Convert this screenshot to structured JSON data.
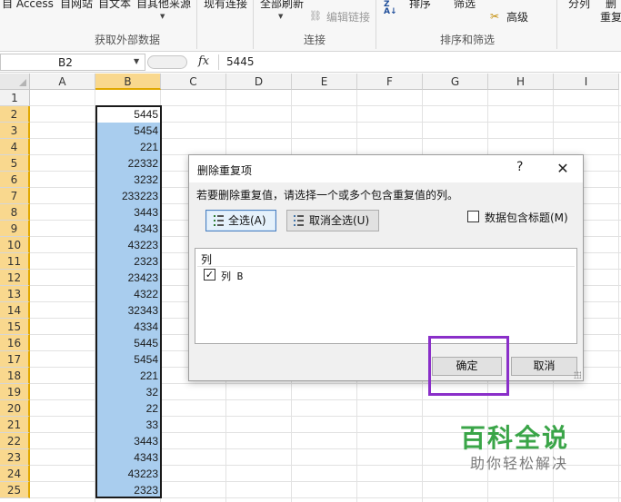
{
  "ribbon": {
    "partial_top": [
      {
        "name": "from-access",
        "label": "自 Access"
      },
      {
        "name": "from-web",
        "label": "自网站"
      },
      {
        "name": "from-text",
        "label": "自文本"
      },
      {
        "name": "from-other-sources",
        "label": "自其他来源"
      },
      {
        "name": "existing-connections",
        "label": "现有连接"
      },
      {
        "name": "refresh-all",
        "label": "全部刷新"
      },
      {
        "name": "sort",
        "label": "排序"
      },
      {
        "name": "filter",
        "label": "筛选"
      },
      {
        "name": "split",
        "label": "分列"
      },
      {
        "name": "remove-dup-partial",
        "label": "删"
      }
    ],
    "edit_links": "编辑链接",
    "advanced": "高级",
    "reapply_partial": "重复",
    "groups": {
      "get_external": "获取外部数据",
      "connections": "连接",
      "sort_filter": "排序和筛选"
    }
  },
  "formula_bar": {
    "name_box": "B2",
    "fx": "fx",
    "value": "5445"
  },
  "grid": {
    "columns": [
      "A",
      "B",
      "C",
      "D",
      "E",
      "F",
      "G",
      "H",
      "I"
    ],
    "selected_column": "B",
    "rows": [
      "1",
      "2",
      "3",
      "4",
      "5",
      "6",
      "7",
      "8",
      "9",
      "10",
      "11",
      "12",
      "13",
      "14",
      "15",
      "16",
      "17",
      "18",
      "19",
      "20",
      "21",
      "22",
      "23",
      "24",
      "25"
    ],
    "column_b_values": [
      "5445",
      "5454",
      "221",
      "22332",
      "3232",
      "233223",
      "3443",
      "4343",
      "43223",
      "2323",
      "23423",
      "4322",
      "32343",
      "4334",
      "5445",
      "5454",
      "221",
      "32",
      "22",
      "33",
      "3443",
      "4343",
      "43223",
      "2323"
    ]
  },
  "dialog": {
    "title": "删除重复项",
    "help": "?",
    "close": "✕",
    "instruction": "若要删除重复值，请选择一个或多个包含重复值的列。",
    "select_all": "全选(A)",
    "unselect_all": "取消全选(U)",
    "has_headers_label": "数据包含标题(M)",
    "has_headers_checked": false,
    "columns_header": "列",
    "column_item_label": "列 B",
    "column_item_checked": true,
    "ok": "确定",
    "cancel": "取消"
  },
  "annotation_color": "#8a2fc9",
  "watermark": {
    "title": "百科全说",
    "subtitle": "助你轻松解决"
  }
}
